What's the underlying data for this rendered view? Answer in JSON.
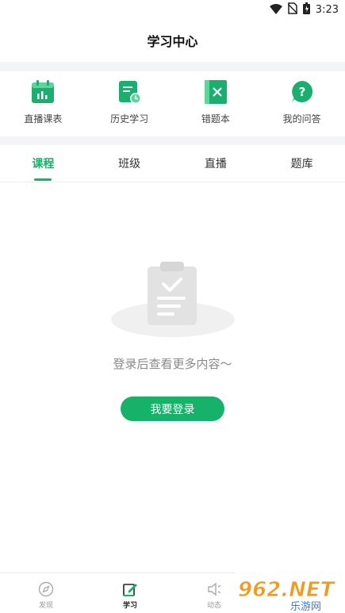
{
  "status_bar": {
    "time": "3:23",
    "icons": [
      "wifi-icon",
      "no-sim-icon",
      "battery-icon"
    ]
  },
  "header": {
    "title": "学习中心"
  },
  "quick_actions": [
    {
      "label": "直播课表",
      "icon": "calendar-chart-icon"
    },
    {
      "label": "历史学习",
      "icon": "history-doc-icon"
    },
    {
      "label": "错题本",
      "icon": "wrong-book-icon"
    },
    {
      "label": "我的问答",
      "icon": "question-bubble-icon"
    }
  ],
  "tabs": [
    {
      "label": "课程",
      "active": true
    },
    {
      "label": "班级",
      "active": false
    },
    {
      "label": "直播",
      "active": false
    },
    {
      "label": "题库",
      "active": false
    }
  ],
  "empty_state": {
    "message": "登录后查看更多内容～",
    "button_label": "我要登录",
    "icon": "clipboard-check-icon"
  },
  "bottom_nav": [
    {
      "label": "发现",
      "icon": "compass-icon",
      "active": false
    },
    {
      "label": "学习",
      "icon": "edit-note-icon",
      "active": true
    },
    {
      "label": "动态",
      "icon": "speaker-icon",
      "active": false
    }
  ],
  "watermark": {
    "brand": "962.NET",
    "subtitle": "乐游网"
  },
  "colors": {
    "accent": "#17b26a",
    "band": "#f3f4f5",
    "muted_text": "#8a8a8a"
  }
}
